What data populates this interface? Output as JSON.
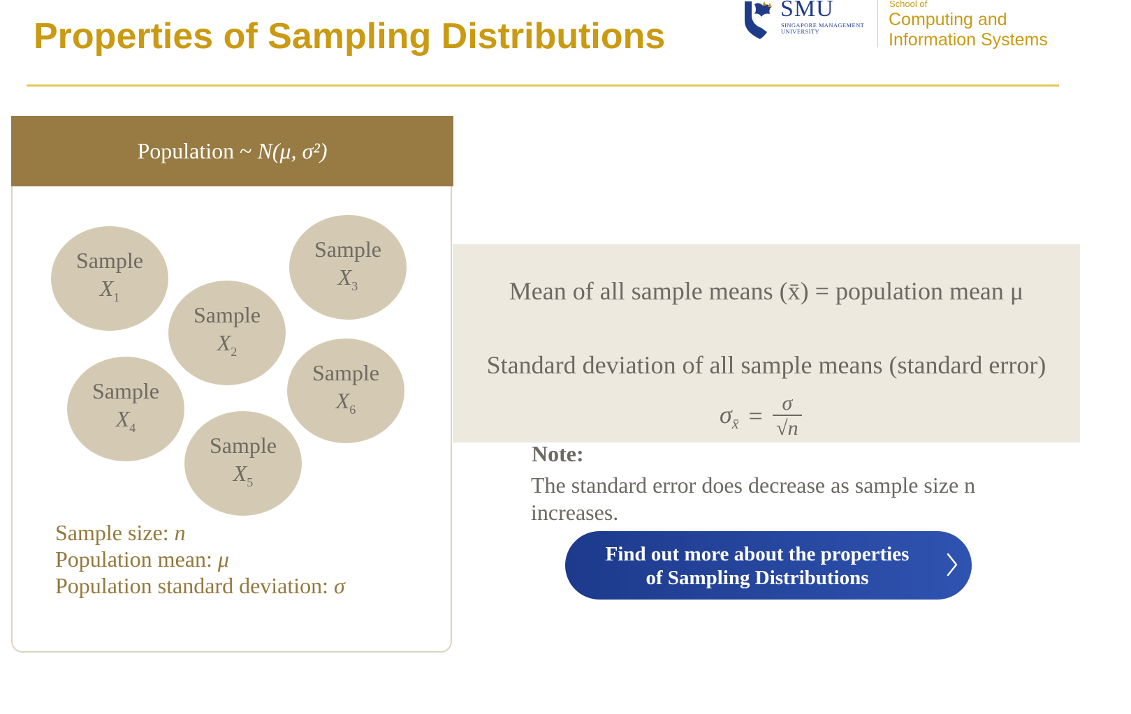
{
  "header": {
    "title": "Properties of Sampling Distributions"
  },
  "logo": {
    "name": "SMU",
    "university_line1": "SINGAPORE MANAGEMENT",
    "university_line2": "UNIVERSITY",
    "school_prefix": "School of",
    "school_line1": "Computing and",
    "school_line2": "Information Systems",
    "brand_blue": "#1f3b8a",
    "brand_gold": "#c99a12"
  },
  "population": {
    "label": "Population ~ ",
    "distribution": "N(μ, σ²)",
    "samples": [
      {
        "word": "Sample",
        "var": "X",
        "index": "1"
      },
      {
        "word": "Sample",
        "var": "X",
        "index": "2"
      },
      {
        "word": "Sample",
        "var": "X",
        "index": "3"
      },
      {
        "word": "Sample",
        "var": "X",
        "index": "4"
      },
      {
        "word": "Sample",
        "var": "X",
        "index": "5"
      },
      {
        "word": "Sample",
        "var": "X",
        "index": "6"
      }
    ],
    "params": [
      {
        "label": "Sample size: ",
        "symbol": "n"
      },
      {
        "label": "Population mean: ",
        "symbol": "μ"
      },
      {
        "label": "Population standard deviation: ",
        "symbol": "σ"
      }
    ]
  },
  "properties": {
    "mean_text": "Mean of all sample means (x̄) = population mean μ",
    "sd_text": "Standard deviation of all sample means (standard error)",
    "formula": {
      "lhs": "σ",
      "lhs_sub": "x̄",
      "equals": "=",
      "numerator": "σ",
      "denominator": "√n"
    }
  },
  "note": {
    "label": "Note:",
    "text": "The standard error does decrease as sample size n increases."
  },
  "cta": {
    "line1": "Find out more about the properties",
    "line2": "of Sampling Distributions"
  },
  "colors": {
    "header_bg": "#977b43",
    "sample_fill": "#d4cab3",
    "panel_bg": "#eee9de",
    "param_text": "#94783c"
  }
}
